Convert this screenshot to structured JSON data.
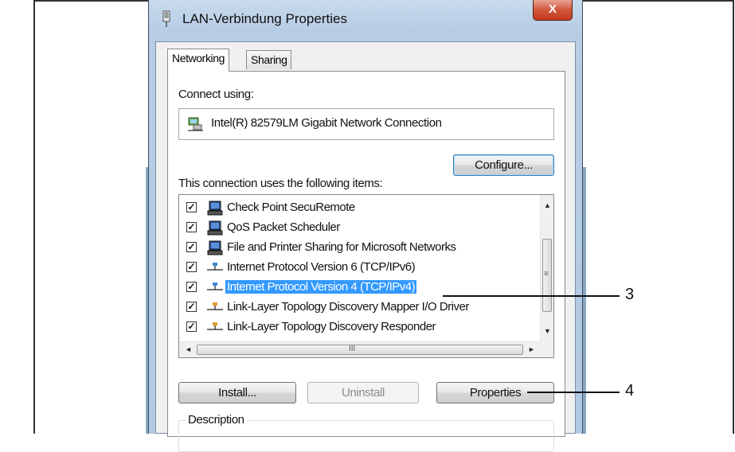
{
  "window": {
    "title": "LAN-Verbindung Properties",
    "close_label": "X"
  },
  "tabs": [
    {
      "label": "Networking",
      "active": true
    },
    {
      "label": "Sharing",
      "active": false
    }
  ],
  "connect_using": {
    "label": "Connect using:",
    "adapter": "Intel(R) 82579LM Gigabit Network Connection"
  },
  "buttons": {
    "configure": "Configure...",
    "install": "Install...",
    "uninstall": "Uninstall",
    "properties": "Properties"
  },
  "items_label": "This connection uses the following items:",
  "items": [
    {
      "label": "Check Point SecuRemote",
      "checked": true,
      "icon": "computer-icon"
    },
    {
      "label": "QoS Packet Scheduler",
      "checked": true,
      "icon": "computer-icon"
    },
    {
      "label": "File and Printer Sharing for Microsoft Networks",
      "checked": true,
      "icon": "computer-icon"
    },
    {
      "label": "Internet Protocol Version 6 (TCP/IPv6)",
      "checked": true,
      "icon": "network-protocol-icon"
    },
    {
      "label": "Internet Protocol Version 4 (TCP/IPv4)",
      "checked": true,
      "icon": "network-protocol-icon",
      "selected": true
    },
    {
      "label": "Link-Layer Topology Discovery Mapper I/O Driver",
      "checked": true,
      "icon": "network-protocol-icon"
    },
    {
      "label": "Link-Layer Topology Discovery Responder",
      "checked": true,
      "icon": "network-protocol-icon"
    }
  ],
  "scroll_glyphs": {
    "up": "▲",
    "down": "▼",
    "left": "◄",
    "right": "►",
    "v_grip": "≡",
    "h_grip": "III"
  },
  "description_label": "Description",
  "callouts": [
    "3",
    "4"
  ],
  "colors": {
    "selection": "#3399ff",
    "titlebar": "#b7cde5",
    "close_button": "#c23a1e"
  }
}
